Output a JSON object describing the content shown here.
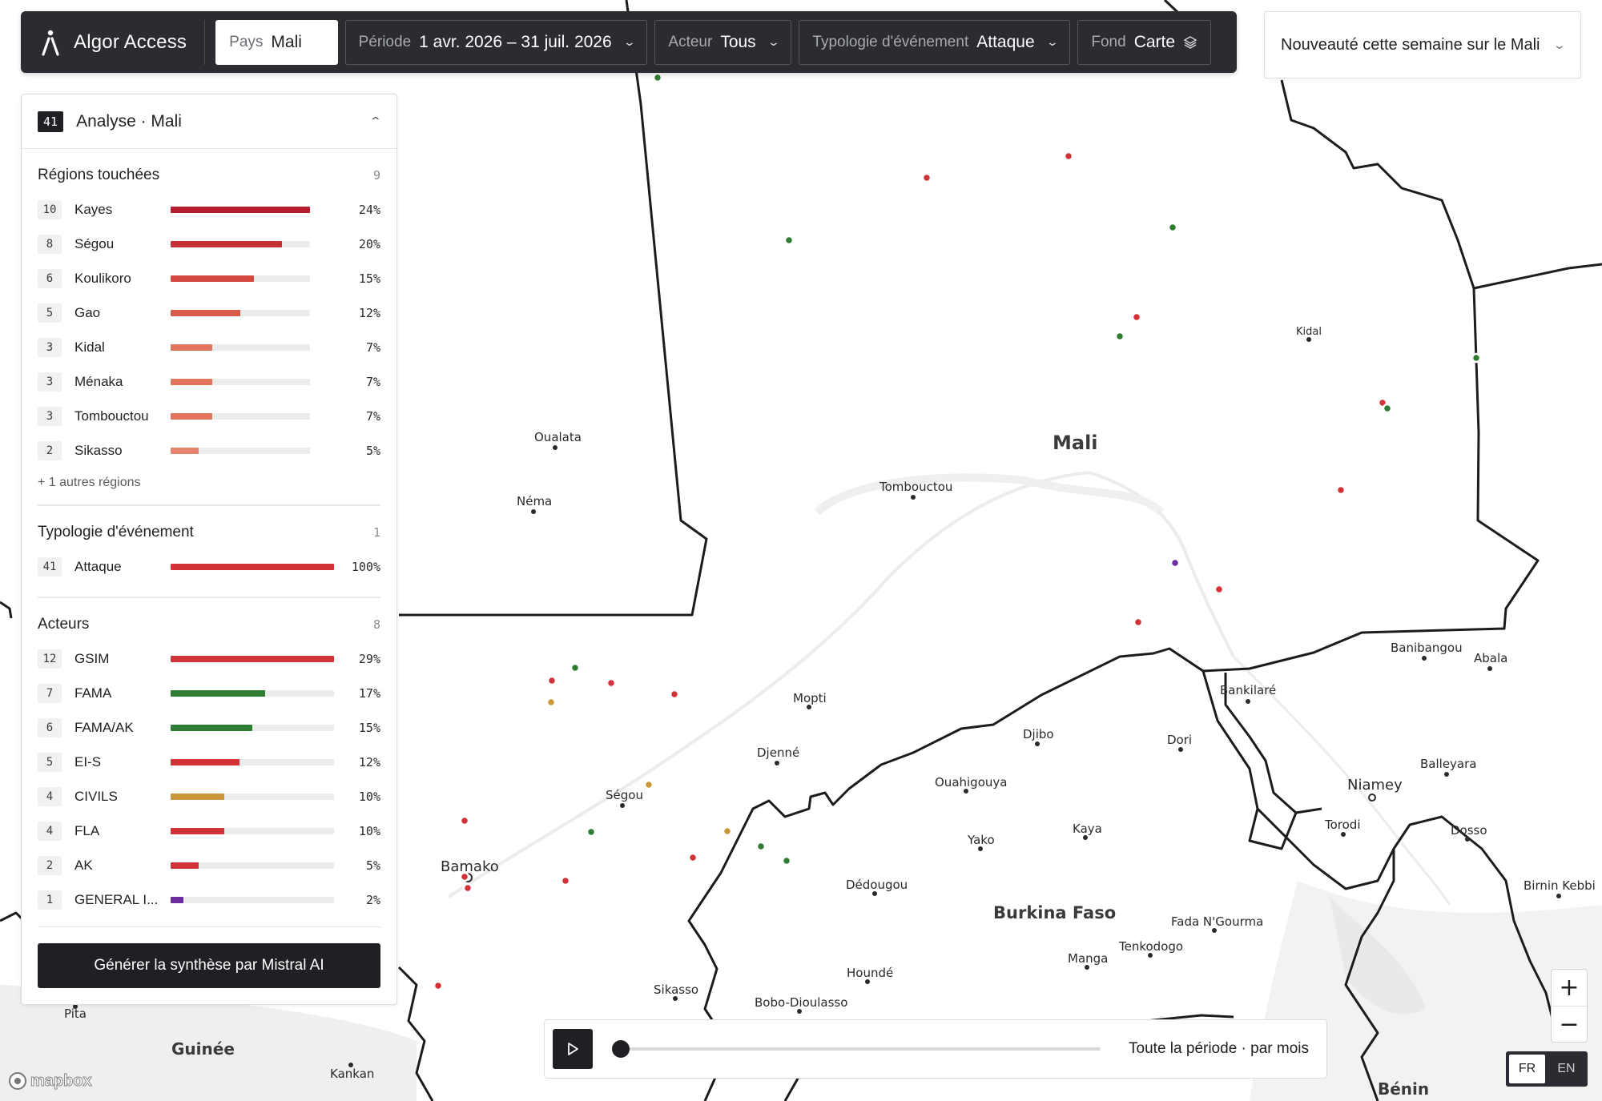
{
  "app": {
    "name": "Algor Access"
  },
  "toolbar": {
    "filters": [
      {
        "key": "Pays",
        "value": "Mali"
      },
      {
        "key": "Période",
        "value": "1 avr. 2026 – 31 juil. 2026"
      },
      {
        "key": "Acteur",
        "value": "Tous"
      },
      {
        "key": "Typologie d'événement",
        "value": "Attaque"
      },
      {
        "key": "Fond",
        "value": "Carte"
      }
    ]
  },
  "news": {
    "text": "Nouveauté cette semaine sur le Mali"
  },
  "panel": {
    "count": "41",
    "title": "Analyse · Mali",
    "regions": {
      "title": "Régions touchées",
      "count": "9",
      "items": [
        {
          "n": "10",
          "label": "Kayes",
          "pct": "24%",
          "frac": 1.0,
          "color": "#b71c2c"
        },
        {
          "n": "8",
          "label": "Ségou",
          "pct": "20%",
          "frac": 0.8,
          "color": "#c62f35"
        },
        {
          "n": "6",
          "label": "Koulikoro",
          "pct": "15%",
          "frac": 0.6,
          "color": "#d2493f"
        },
        {
          "n": "5",
          "label": "Gao",
          "pct": "12%",
          "frac": 0.5,
          "color": "#d95948"
        },
        {
          "n": "3",
          "label": "Kidal",
          "pct": "7%",
          "frac": 0.3,
          "color": "#e2735d"
        },
        {
          "n": "3",
          "label": "Ménaka",
          "pct": "7%",
          "frac": 0.3,
          "color": "#e2735d"
        },
        {
          "n": "3",
          "label": "Tombouctou",
          "pct": "7%",
          "frac": 0.3,
          "color": "#e2735d"
        },
        {
          "n": "2",
          "label": "Sikasso",
          "pct": "5%",
          "frac": 0.2,
          "color": "#e8836b"
        }
      ],
      "more": "+ 1 autres régions"
    },
    "types": {
      "title": "Typologie d'événement",
      "count": "1",
      "items": [
        {
          "n": "41",
          "label": "Attaque",
          "pct": "100%",
          "frac": 1.0,
          "color": "#d03238"
        }
      ]
    },
    "actors": {
      "title": "Acteurs",
      "count": "8",
      "items": [
        {
          "n": "12",
          "label": "GSIM",
          "pct": "29%",
          "frac": 1.0,
          "color": "#d03238"
        },
        {
          "n": "7",
          "label": "FAMA",
          "pct": "17%",
          "frac": 0.58,
          "color": "#2e7d32"
        },
        {
          "n": "6",
          "label": "FAMA/AK",
          "pct": "15%",
          "frac": 0.5,
          "color": "#2e7d32"
        },
        {
          "n": "5",
          "label": "EI-S",
          "pct": "12%",
          "frac": 0.42,
          "color": "#d03238"
        },
        {
          "n": "4",
          "label": "CIVILS",
          "pct": "10%",
          "frac": 0.33,
          "color": "#c9973a"
        },
        {
          "n": "4",
          "label": "FLA",
          "pct": "10%",
          "frac": 0.33,
          "color": "#d03238"
        },
        {
          "n": "2",
          "label": "AK",
          "pct": "5%",
          "frac": 0.17,
          "color": "#d03238"
        },
        {
          "n": "1",
          "label": "GENERAL I...",
          "pct": "2%",
          "frac": 0.08,
          "color": "#6a2ca0"
        }
      ]
    },
    "mistral_button": "Générer la synthèse par Mistral AI"
  },
  "timeline": {
    "label": "Toute la période · par mois",
    "progress": 0
  },
  "zoom": {
    "in": "+",
    "out": "−"
  },
  "lang": {
    "fr": "FR",
    "en": "EN",
    "selected": "FR"
  },
  "attribution": "mapbox",
  "map": {
    "places": [
      "Mali",
      "Burkina Faso",
      "Guinée",
      "Bénin",
      "Kidal",
      "Tombouctou",
      "Oualata",
      "Néma",
      "Mopti",
      "Djenné",
      "Ségou",
      "Bamako",
      "Sikasso",
      "Bobo-Dioulasso",
      "Houndé",
      "Dédougou",
      "Ouahigouya",
      "Djibo",
      "Dori",
      "Yako",
      "Kaya",
      "Manga",
      "Tenkodogo",
      "Fada N'Gourma",
      "Bankilaré",
      "Banibangou",
      "Abala",
      "Balleyara",
      "Niamey",
      "Torodi",
      "Dosso",
      "Birnin Kebbi",
      "Pita",
      "Kankan"
    ]
  }
}
